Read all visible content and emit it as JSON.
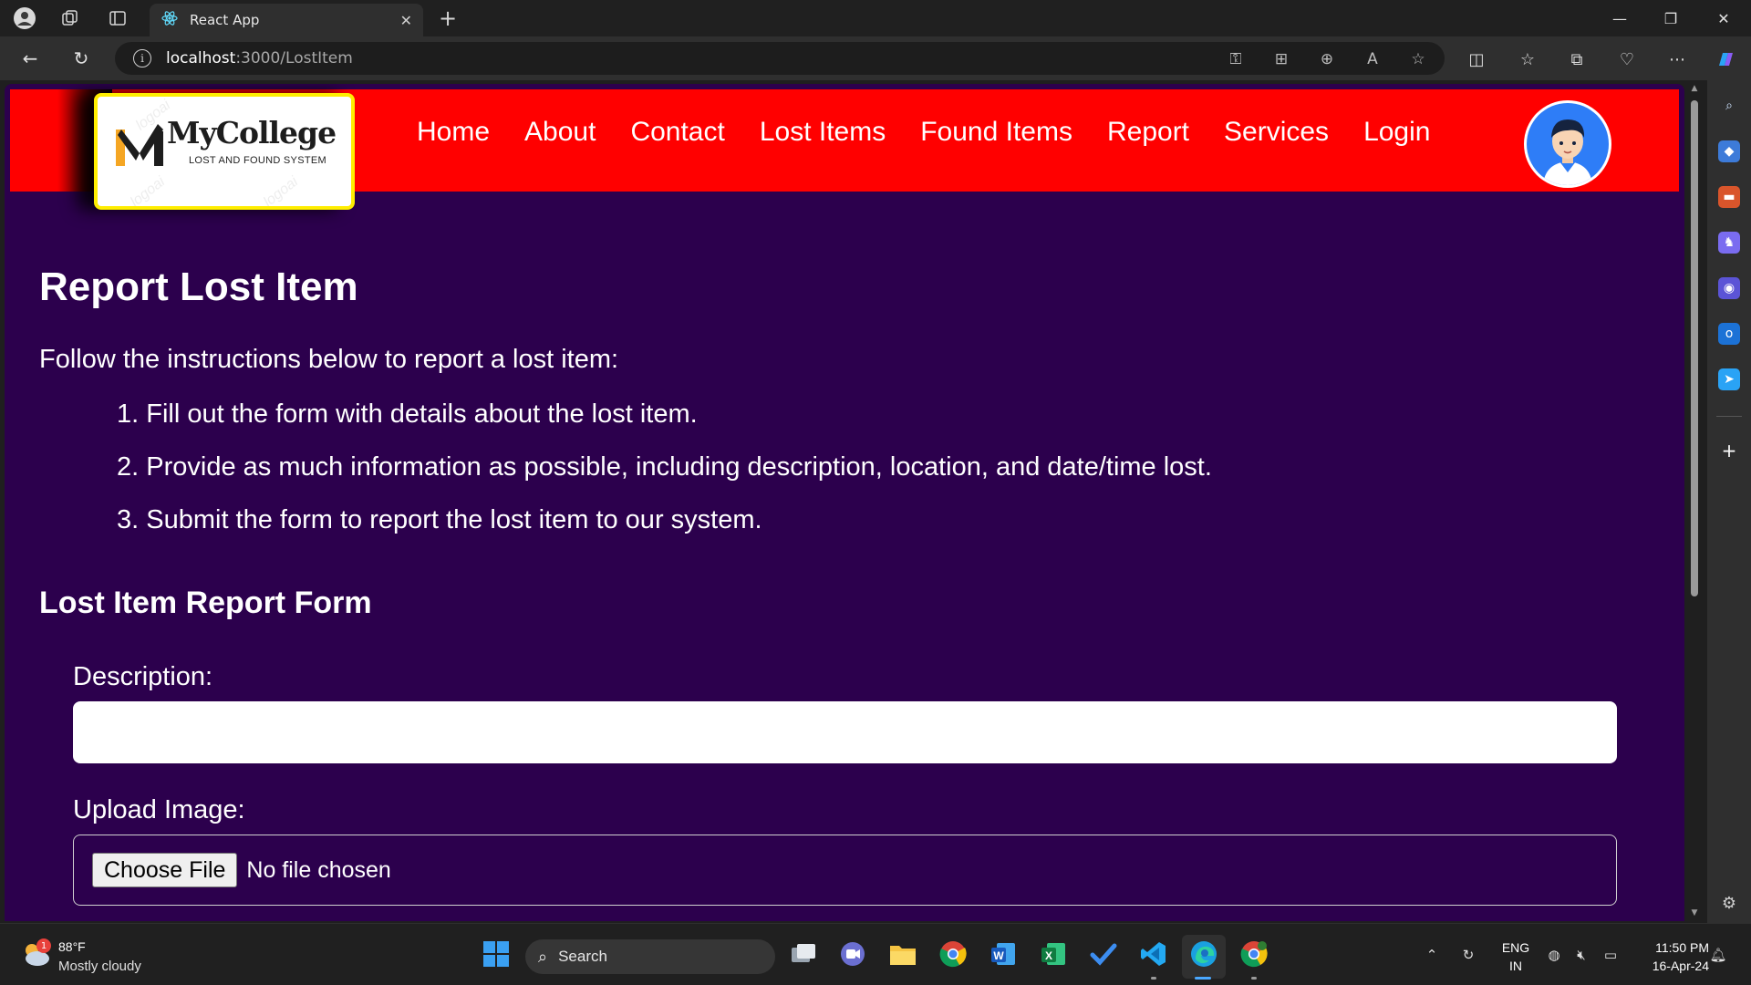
{
  "browser": {
    "tab_title": "React App",
    "address_host": "localhost",
    "address_path": ":3000/LostItem"
  },
  "site": {
    "logo_title": "MyCollege",
    "logo_subtitle": "LOST AND FOUND SYSTEM",
    "nav": [
      "Home",
      "About",
      "Contact",
      "Lost Items",
      "Found Items",
      "Report",
      "Services",
      "Login"
    ]
  },
  "content": {
    "title": "Report Lost Item",
    "intro": "Follow the instructions below to report a lost item:",
    "steps": [
      "1. Fill out the form with details about the lost item.",
      "2. Provide as much information as possible, including description, location, and date/time lost.",
      "3. Submit the form to report the lost item to our system."
    ],
    "form_title": "Lost Item Report Form",
    "description_label": "Description:",
    "description_value": "",
    "upload_label": "Upload Image:",
    "file_button": "Choose File",
    "file_status": "No file chosen"
  },
  "taskbar": {
    "weather_badge": "1",
    "temperature": "88°F",
    "weather": "Mostly cloudy",
    "search_label": "Search",
    "lang": "ENG",
    "region": "IN",
    "time": "11:50 PM",
    "date": "16-Apr-24"
  },
  "colors": {
    "header_bg": "#ff0000",
    "page_bg": "#2c004d",
    "logo_border": "#ffee00",
    "avatar_bg": "#2e7df7"
  }
}
